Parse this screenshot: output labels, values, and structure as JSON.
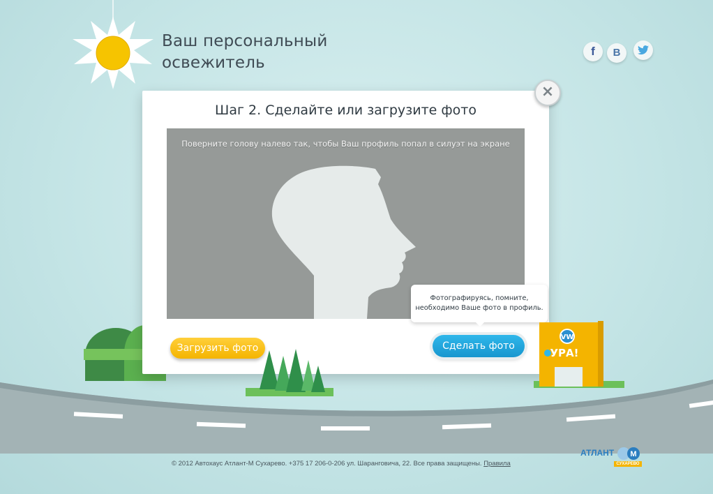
{
  "header": {
    "title_line1": "Ваш персональный",
    "title_line2": "освежитель",
    "social": [
      {
        "label": "f",
        "icon": "facebook-icon"
      },
      {
        "label": "В",
        "icon": "vkontakte-icon"
      },
      {
        "label": "",
        "icon": "twitter-icon"
      }
    ]
  },
  "modal": {
    "title": "Шаг 2. Сделайте или загрузите фото",
    "close_label": "×",
    "camera_hint": "Поверните голову налево так, чтобы Ваш профиль попал в силуэт на экране",
    "tooltip_line1": "Фотографируясь, помните,",
    "tooltip_line2": "необходимо Ваше фото в профиль.",
    "upload_button": "Загрузить фото",
    "shoot_button": "Сделать фото"
  },
  "scene": {
    "gate_label": "УРА!"
  },
  "footer": {
    "copyright": "© 2012 Автохаус Атлант-М Сухарево. +375 17 206-0-206 ул. Шаранговича, 22. Все права защищены.",
    "rules_link": "Правила",
    "logo_text": "АТЛАНТ",
    "logo_sub": "СУХАРЕВО"
  },
  "colors": {
    "accent_yellow": "#f4b400",
    "accent_blue": "#1797cf",
    "background": "#c5e5e6"
  }
}
